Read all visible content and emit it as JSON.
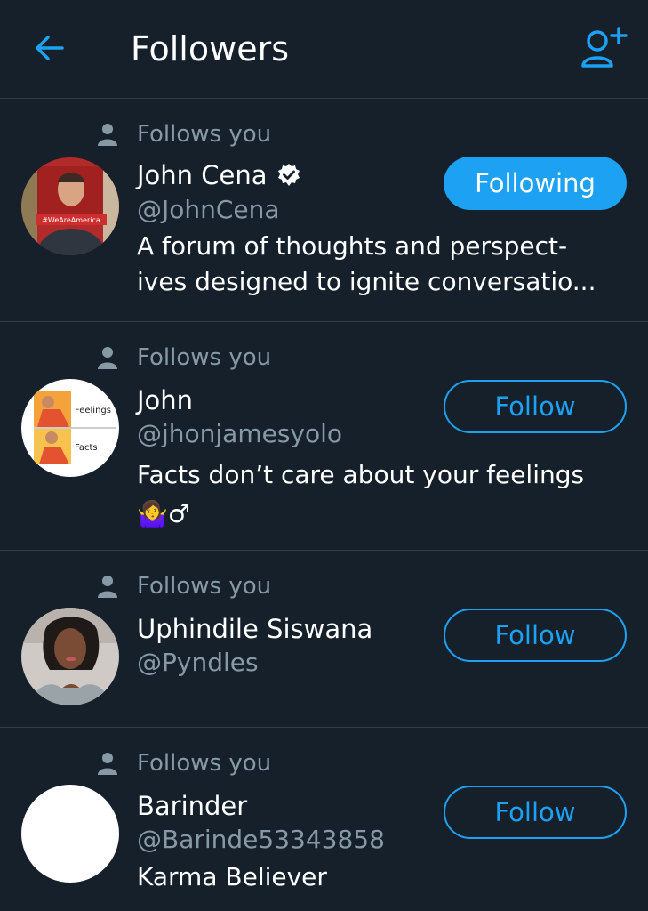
{
  "header": {
    "title": "Followers",
    "back_icon": "arrow-left-icon",
    "add_user_icon": "add-user-icon"
  },
  "colors": {
    "background": "#15202b",
    "accent": "#1da1f2",
    "muted": "#8899a6",
    "divider": "#2f3b47"
  },
  "followers": [
    {
      "follows_you": "Follows you",
      "name": "John Cena",
      "verified": true,
      "handle": "@JohnCena",
      "bio_line1": "A forum of thoughts and perspect-",
      "bio_line2": "ives designed to ignite conversatio...",
      "button": "Following",
      "avatar_text": "#WeAreAmerica"
    },
    {
      "follows_you": "Follows you",
      "name": "John",
      "verified": false,
      "handle": "@jhonjamesyolo",
      "bio_line1": "Facts don’t care about your feelings",
      "bio_line2": "🤷‍♀️♂",
      "button": "Follow",
      "avatar_text_top": "Feelings",
      "avatar_text_bottom": "Facts"
    },
    {
      "follows_you": "Follows you",
      "name": "Uphindile Siswana",
      "verified": false,
      "handle": "@Pyndles",
      "button": "Follow"
    },
    {
      "follows_you": "Follows you",
      "name": "Barinder",
      "verified": false,
      "handle": "@Barinde53343858",
      "bio_line1": "Karma Believer",
      "button": "Follow"
    }
  ]
}
